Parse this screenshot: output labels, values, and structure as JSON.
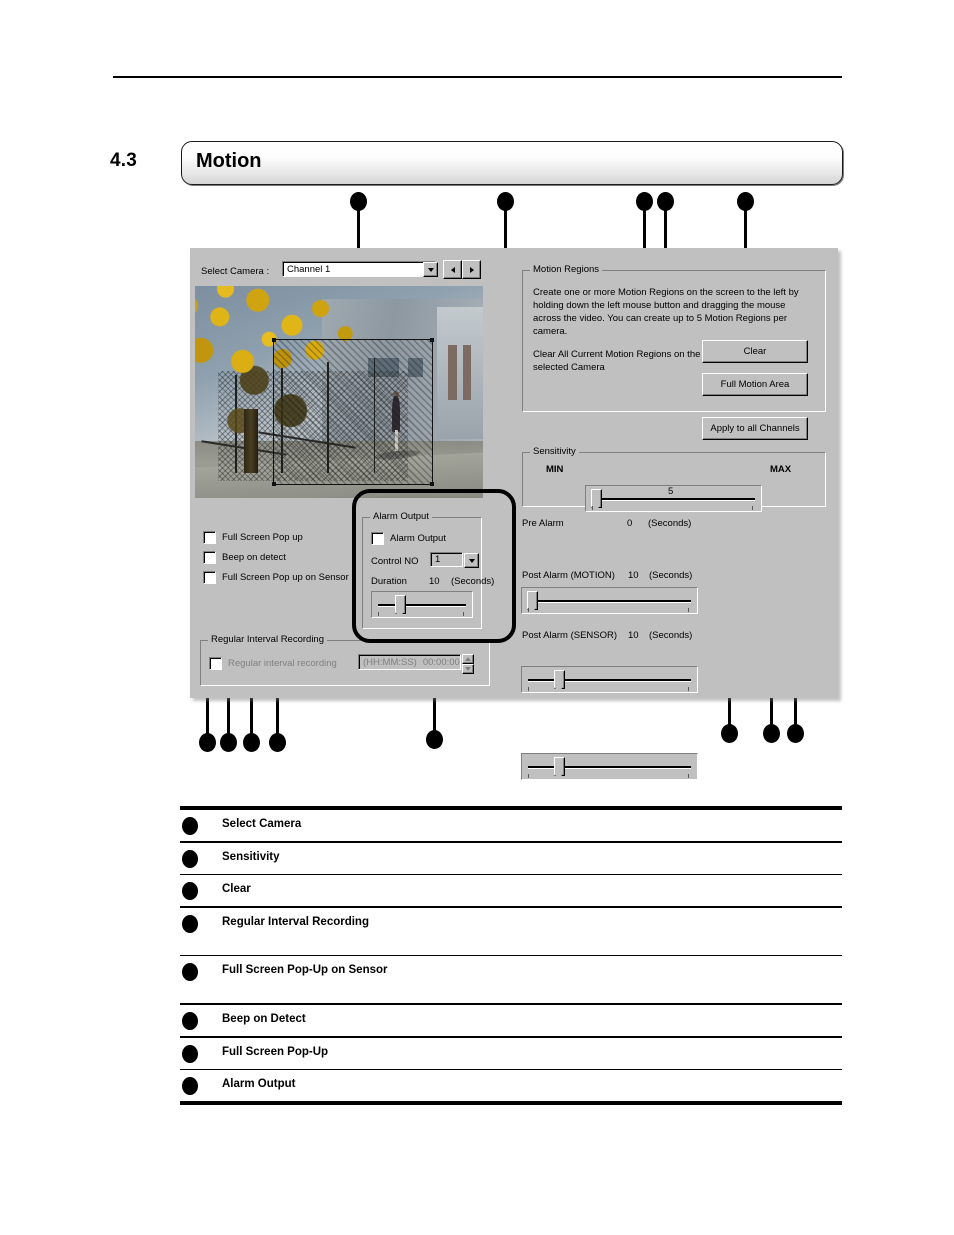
{
  "page": {
    "section_number": "4.3",
    "section_title": "Motion"
  },
  "dialog": {
    "select_camera_label": "Select Camera :",
    "camera_value": "Channel 1",
    "prev_icon": "left-triangle-icon",
    "next_icon": "right-triangle-icon",
    "checkboxes": [
      {
        "label": "Full Screen Pop up",
        "checked": false
      },
      {
        "label": "Beep on detect",
        "checked": false
      },
      {
        "label": "Full Screen Pop up on Sensor",
        "checked": false
      }
    ],
    "regular_interval": {
      "group_title": "Regular Interval Recording",
      "checkbox_label": "Regular interval recording",
      "checked": false,
      "format_hint": "(HH:MM:SS)",
      "time_value": "00:00:00",
      "spinner_up_icon": "spinner-up-icon",
      "spinner_down_icon": "spinner-down-icon"
    },
    "alarm_output": {
      "group_title": "Alarm Output",
      "checkbox_label": "Alarm Output",
      "checked": false,
      "control_no_label": "Control NO",
      "control_no_value": "1",
      "duration_label": "Duration",
      "duration_value": "10",
      "duration_units": "(Seconds)"
    },
    "motion_regions": {
      "group_title": "Motion Regions",
      "description": "Create one or more Motion Regions on the screen to the left by holding down the left mouse button and dragging the mouse across the video. You can create up to 5 Motion Regions per camera.",
      "clear_description": "Clear All Current Motion Regions on the selected Camera",
      "clear_button": "Clear",
      "full_motion_button": "Full Motion Area",
      "apply_all_button": "Apply to all Channels"
    },
    "sensitivity": {
      "group_title": "Sensitivity",
      "min_label": "MIN",
      "max_label": "MAX",
      "value": "5"
    },
    "alarm_sliders": [
      {
        "label": "Pre Alarm",
        "value": "0",
        "units": "(Seconds)",
        "thumb_pct": 3
      },
      {
        "label": "Post Alarm (MOTION)",
        "value": "10",
        "units": "(Seconds)",
        "thumb_pct": 19
      },
      {
        "label": "Post Alarm (SENSOR)",
        "value": "10",
        "units": "(Seconds)",
        "thumb_pct": 19
      }
    ]
  },
  "legend": {
    "items": [
      {
        "label": "Select Camera"
      },
      {
        "label": "Sensitivity"
      },
      {
        "label": "Clear"
      },
      {
        "label": "Regular Interval Recording"
      },
      {
        "label": "Full Screen Pop-Up on Sensor"
      },
      {
        "label": "Beep on Detect"
      },
      {
        "label": "Full Screen Pop-Up"
      },
      {
        "label": "Alarm Output"
      }
    ]
  },
  "colors": {
    "dialog_face": "#c0c0c0",
    "callout": "#000000",
    "accent_foliage": "#d8b42a"
  }
}
